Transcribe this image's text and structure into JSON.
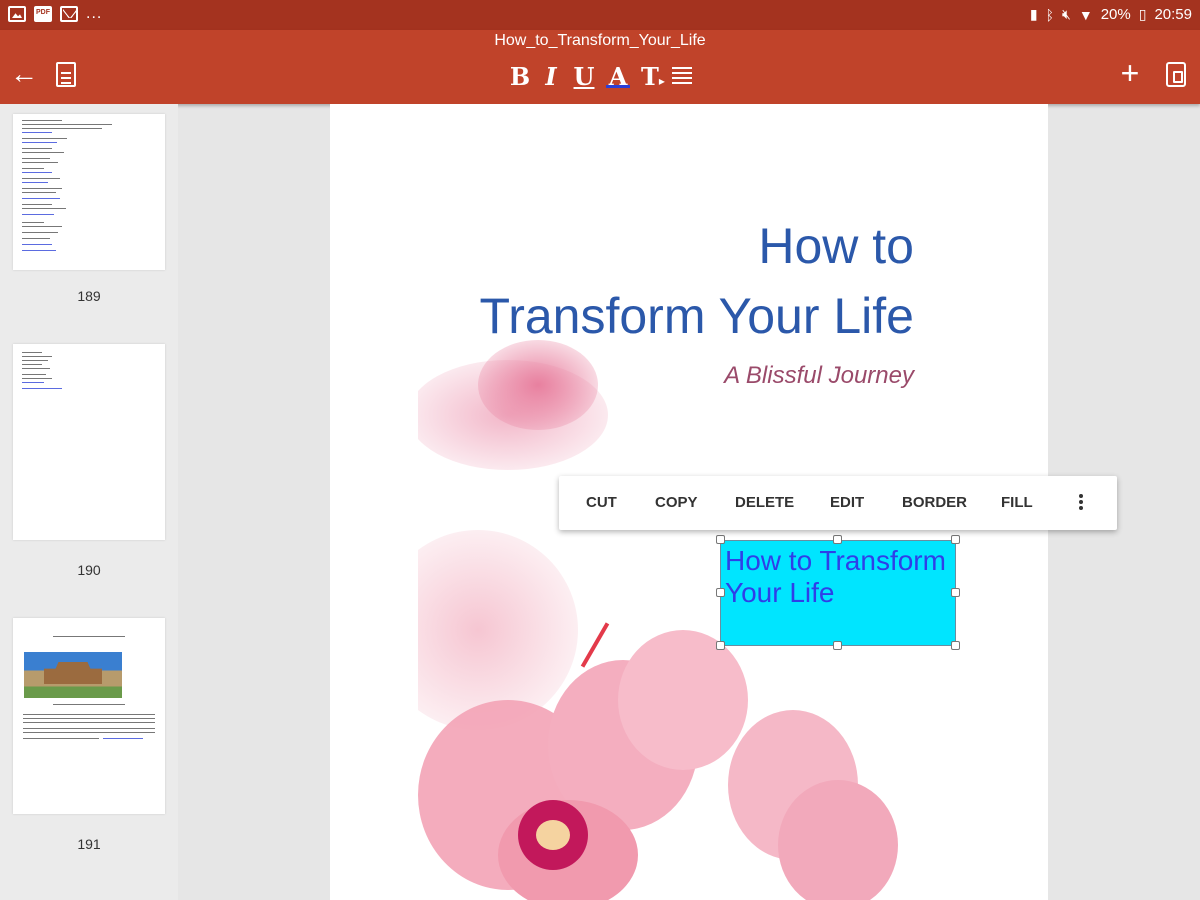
{
  "status_bar": {
    "battery": "20%",
    "time": "20:59",
    "overflow": "..."
  },
  "toolbar": {
    "document_title": "How_to_Transform_Your_Life",
    "format": {
      "bold": "B",
      "italic": "I",
      "underline": "U",
      "font_color": "A",
      "font_size": "T",
      "accent_color": "#2b3fd6"
    },
    "add": "+"
  },
  "sidebar": {
    "thumbnails": [
      {
        "page_number": "189"
      },
      {
        "page_number": "190"
      },
      {
        "page_number": "191"
      }
    ]
  },
  "document": {
    "title_line1": "How to",
    "title_line2": "Transform Your Life",
    "subtitle": "A Blissful Journey",
    "selected_textbox": {
      "text_line1": "How to Transform",
      "text_line2": "Your Life",
      "fill_color": "#00e5ff"
    }
  },
  "context_menu": {
    "items": [
      "CUT",
      "COPY",
      "DELETE",
      "EDIT",
      "BORDER",
      "FILL"
    ]
  },
  "colors": {
    "toolbar": "#c0432a",
    "status_bar": "#a4331f",
    "title_blue": "#2b58aa"
  }
}
